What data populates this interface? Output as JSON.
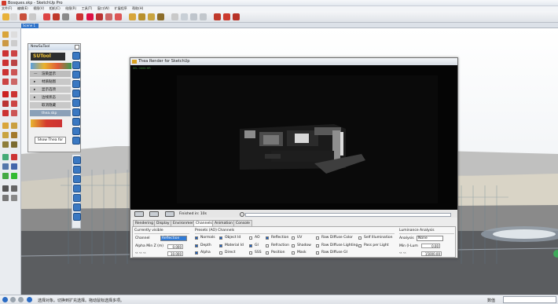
{
  "window": {
    "title": "Bosques.skp - SketchUp Pro"
  },
  "menu": [
    "文件(F)",
    "编辑(E)",
    "视图(V)",
    "相机(C)",
    "绘图(R)",
    "工具(T)",
    "窗口(W)",
    "扩展程序",
    "帮助(H)"
  ],
  "scene_tab": "Scene 1",
  "status": {
    "text": "选择对象。切换到扩充选择。拖动鼠标选择多项。",
    "measurement_label": "数值"
  },
  "nsutool": {
    "title": "NewSuTool",
    "logo": "SUTool",
    "rows": [
      "渲染显示",
      "材质贴图",
      "显示选项",
      "边线状态",
      "取消隐藏"
    ],
    "selected": "thea.skp",
    "show_button": "Show Thea for"
  },
  "thea": {
    "title": "Thea Render for SketchUp",
    "render_info": "SEL 0000:HR",
    "finished": "Finished in: 10s",
    "tabs": [
      "Rendering",
      "Display",
      "Environment",
      "Channels",
      "Animation",
      "Console"
    ],
    "active_tab": "Channels",
    "currently_visible": {
      "heading": "Currently visible",
      "channel_label": "Channel",
      "channel_value": "Reflection",
      "alpha_label": "Alpha Min Z (m)",
      "alpha_value": "0.000",
      "max_value": "10.000"
    },
    "presets": {
      "heading": "Presets (AO) Channels",
      "col1": [
        {
          "label": "Normals",
          "on": true
        },
        {
          "label": "Depth",
          "on": true
        },
        {
          "label": "Alpha",
          "on": true
        }
      ],
      "col2": [
        {
          "label": "Object Id",
          "on": true
        },
        {
          "label": "Material Id",
          "on": true
        },
        {
          "label": "Direct",
          "on": false
        }
      ],
      "col3": [
        {
          "label": "AO",
          "on": false
        },
        {
          "label": "GI",
          "on": true
        },
        {
          "label": "SSS",
          "on": false
        }
      ],
      "col4": [
        {
          "label": "Reflection",
          "on": true
        },
        {
          "label": "Refraction",
          "on": false
        },
        {
          "label": "Position",
          "on": false
        }
      ],
      "col5": [
        {
          "label": "UV",
          "on": false
        },
        {
          "label": "Shadow",
          "on": false
        },
        {
          "label": "Mask",
          "on": false
        }
      ],
      "col6": [
        {
          "label": "Raw Diffuse Color",
          "on": false
        },
        {
          "label": "Raw Diffuse Lighting",
          "on": false
        },
        {
          "label": "Raw Diffuse GI",
          "on": false
        }
      ],
      "col7": [
        {
          "label": "Self Illumination",
          "on": false
        },
        {
          "label": "Pass per Light",
          "on": false
        }
      ]
    },
    "luminance": {
      "heading": "Luminance Analysis",
      "analysis_label": "Analysis",
      "analysis_value": "None",
      "min_label": "Min (l-Lum",
      "min_value": "0.00",
      "max_value": "15000.00"
    }
  }
}
